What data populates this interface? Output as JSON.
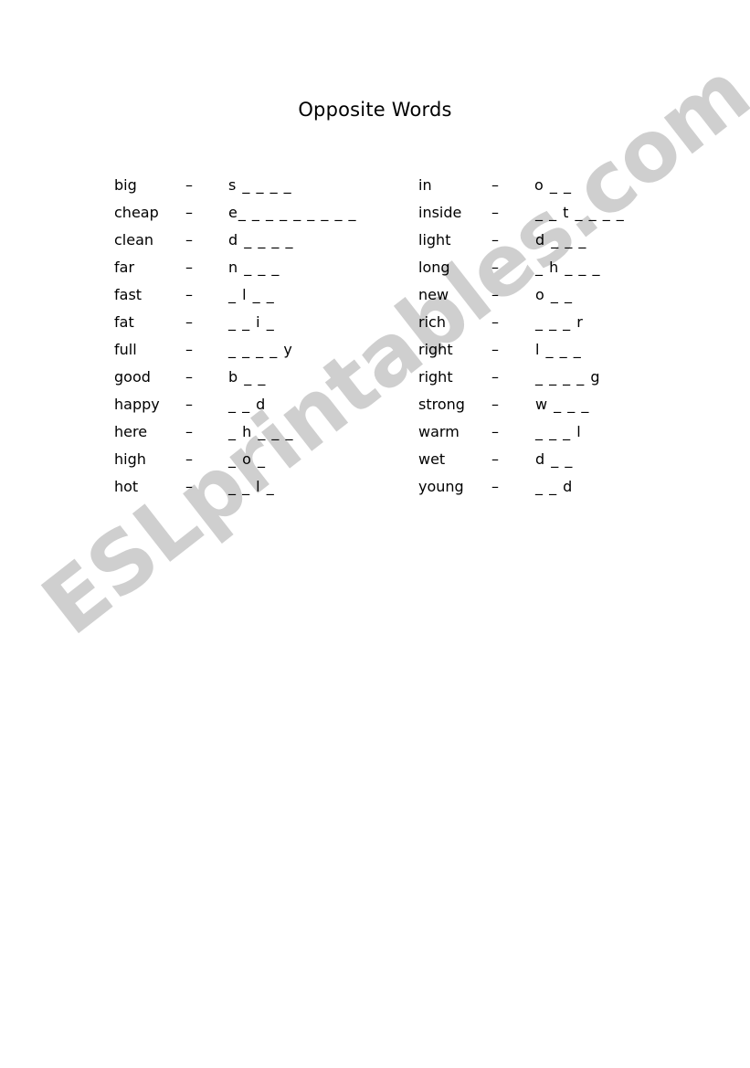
{
  "page": {
    "title": "Opposite Words",
    "background_color": "#ffffff",
    "text_color": "#000000"
  },
  "watermark": {
    "text": "ESLprintables.com",
    "color": "#cfcfcf"
  },
  "separator": "–",
  "columns": {
    "left": [
      {
        "term": "big",
        "dash": "–",
        "answer": "s _ _ _ _"
      },
      {
        "term": "cheap",
        "dash": "–",
        "answer": "e_ _ _ _ _ _ _ _ _"
      },
      {
        "term": "clean",
        "dash": "–",
        "answer": "d _ _ _ _"
      },
      {
        "term": "far",
        "dash": "–",
        "answer": "n _ _ _"
      },
      {
        "term": "fast",
        "dash": "–",
        "answer": "_ l _ _"
      },
      {
        "term": "fat",
        "dash": "–",
        "answer": "_ _ i _"
      },
      {
        "term": "full",
        "dash": "–",
        "answer": "_ _ _ _ y"
      },
      {
        "term": "good",
        "dash": "–",
        "answer": "b _ _"
      },
      {
        "term": "happy",
        "dash": "–",
        "answer": "_ _ d"
      },
      {
        "term": "here",
        "dash": "–",
        "answer": "_ h _ _ _"
      },
      {
        "term": "high",
        "dash": "–",
        "answer": "_ o _"
      },
      {
        "term": "hot",
        "dash": "–",
        "answer": "_ _ l _"
      }
    ],
    "right": [
      {
        "term": "in",
        "dash": "–",
        "answer": "o _ _"
      },
      {
        "term": "inside",
        "dash": "–",
        "answer": "_ _ t _ _ _ _"
      },
      {
        "term": "light",
        "dash": "–",
        "answer": "d _ _ _"
      },
      {
        "term": "long",
        "dash": "–",
        "answer": "_ h _ _ _"
      },
      {
        "term": "new",
        "dash": "–",
        "answer": "o _ _"
      },
      {
        "term": "rich",
        "dash": "–",
        "answer": "_ _ _ r"
      },
      {
        "term": "right",
        "dash": "–",
        "answer": "l _ _ _"
      },
      {
        "term": "right",
        "dash": "–",
        "answer": "_ _ _ _ g"
      },
      {
        "term": "strong",
        "dash": "–",
        "answer": "w _ _ _"
      },
      {
        "term": "warm",
        "dash": "–",
        "answer": "_ _ _ l"
      },
      {
        "term": "wet",
        "dash": "–",
        "answer": "d _ _"
      },
      {
        "term": "young",
        "dash": "–",
        "answer": "_ _ d"
      }
    ]
  }
}
